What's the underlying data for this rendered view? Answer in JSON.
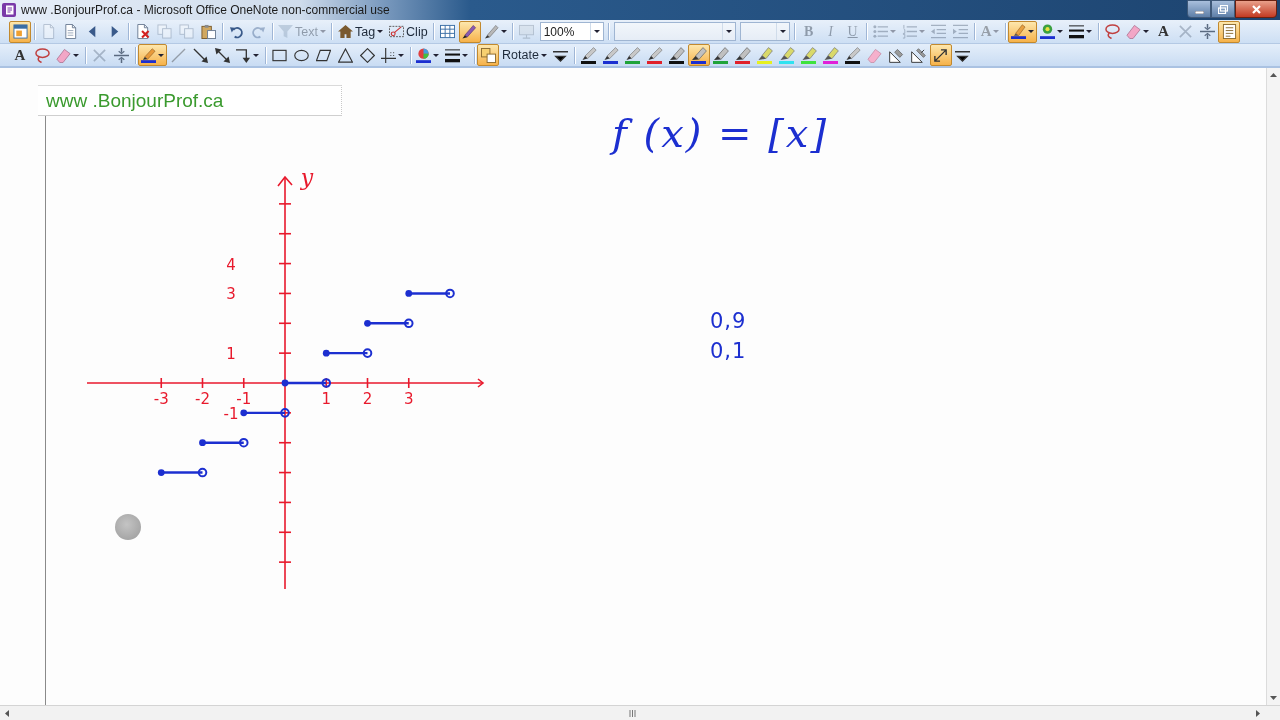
{
  "window": {
    "title": "www .BonjourProf.ca - Microsoft Office OneNote non-commercial use"
  },
  "standard_toolbar": {
    "groups": [
      {
        "items": [
          {
            "kind": "icon",
            "selected": true,
            "disabled": false,
            "menu": false
          }
        ]
      },
      {
        "items": [
          {
            "kind": "icon",
            "selected": false,
            "disabled": true,
            "menu": false
          },
          {
            "kind": "icon",
            "selected": false,
            "disabled": false,
            "menu": false
          },
          {
            "kind": "icon",
            "selected": false,
            "disabled": false,
            "menu": false
          },
          {
            "kind": "icon",
            "selected": false,
            "disabled": false,
            "menu": false
          }
        ]
      },
      {
        "items": [
          {
            "kind": "icon",
            "selected": false,
            "disabled": false,
            "menu": false
          },
          {
            "kind": "icon",
            "selected": false,
            "disabled": true,
            "menu": false
          },
          {
            "kind": "icon",
            "selected": false,
            "disabled": true,
            "menu": false
          },
          {
            "kind": "icon",
            "selected": false,
            "disabled": false,
            "menu": false
          }
        ]
      },
      {
        "items": [
          {
            "kind": "icon",
            "selected": false,
            "disabled": false,
            "menu": false
          },
          {
            "kind": "icon",
            "selected": false,
            "disabled": true,
            "menu": false
          }
        ]
      },
      {
        "items": [
          {
            "kind": "text",
            "label": "Text",
            "selected": false,
            "disabled": true,
            "menu": true
          }
        ]
      },
      {
        "items": [
          {
            "kind": "text",
            "label": "Tag",
            "selected": false,
            "disabled": false,
            "menu": true
          },
          {
            "kind": "text",
            "label": "Clip",
            "selected": false,
            "disabled": false,
            "menu": false
          }
        ]
      },
      {
        "items": [
          {
            "kind": "icon",
            "selected": false,
            "disabled": false,
            "menu": false
          },
          {
            "kind": "icon",
            "selected": true,
            "disabled": false,
            "menu": false
          },
          {
            "kind": "icon",
            "selected": false,
            "disabled": false,
            "menu": true
          }
        ]
      },
      {
        "items": [
          {
            "kind": "icon",
            "selected": false,
            "disabled": true,
            "menu": false
          },
          {
            "kind": "dropdown",
            "value": "100%",
            "selected": false,
            "disabled": false,
            "menu": true
          }
        ]
      },
      {
        "items": [
          {
            "kind": "dropdown",
            "selected": false,
            "disabled": false,
            "menu": true
          },
          {
            "kind": "dropdown",
            "selected": false,
            "disabled": false,
            "menu": true
          }
        ]
      },
      {
        "items": [
          {
            "kind": "bold",
            "label": "B",
            "selected": false,
            "disabled": true,
            "menu": false
          },
          {
            "kind": "italic",
            "label": "I",
            "selected": false,
            "disabled": true,
            "menu": false
          },
          {
            "kind": "underline",
            "label": "U",
            "selected": false,
            "disabled": true,
            "menu": false
          }
        ]
      },
      {
        "items": [
          {
            "kind": "icon",
            "selected": false,
            "disabled": true,
            "menu": true
          },
          {
            "kind": "icon",
            "selected": false,
            "disabled": true,
            "menu": true
          },
          {
            "kind": "icon",
            "selected": false,
            "disabled": true,
            "menu": false
          },
          {
            "kind": "icon",
            "selected": false,
            "disabled": true,
            "menu": false
          }
        ]
      },
      {
        "items": [
          {
            "kind": "glyph",
            "label": "A",
            "selected": false,
            "disabled": true,
            "menu": true
          }
        ]
      },
      {
        "items": [
          {
            "kind": "icon",
            "selected": true,
            "disabled": false,
            "menu": true
          },
          {
            "kind": "icon",
            "selected": false,
            "disabled": false,
            "menu": true
          },
          {
            "kind": "icon",
            "selected": false,
            "disabled": false,
            "menu": true
          }
        ]
      },
      {
        "items": [
          {
            "kind": "icon",
            "selected": false,
            "disabled": false,
            "menu": false
          },
          {
            "kind": "icon",
            "selected": false,
            "disabled": false,
            "menu": true
          },
          {
            "kind": "glyph",
            "label": "A",
            "selected": false,
            "disabled": false,
            "menu": false
          },
          {
            "kind": "icon",
            "selected": false,
            "disabled": true,
            "menu": false
          },
          {
            "kind": "icon",
            "selected": false,
            "disabled": false,
            "menu": false
          },
          {
            "kind": "icon",
            "selected": true,
            "disabled": false,
            "menu": false
          }
        ]
      }
    ]
  },
  "drawing_toolbar": {
    "groups": [
      {
        "items": [
          {
            "kind": "glyph",
            "label": "A",
            "selected": false,
            "disabled": false,
            "menu": false
          },
          {
            "kind": "icon",
            "selected": false,
            "disabled": false,
            "menu": false
          },
          {
            "kind": "icon",
            "selected": false,
            "disabled": false,
            "menu": true
          }
        ]
      },
      {
        "items": [
          {
            "kind": "icon",
            "selected": false,
            "disabled": true,
            "menu": false
          },
          {
            "kind": "icon",
            "selected": false,
            "disabled": false,
            "menu": false
          }
        ]
      },
      {
        "items": [
          {
            "kind": "icon",
            "selected": true,
            "disabled": false,
            "menu": true
          },
          {
            "kind": "icon",
            "selected": false,
            "disabled": true,
            "menu": false
          },
          {
            "kind": "icon",
            "selected": false,
            "disabled": false,
            "menu": false
          },
          {
            "kind": "icon",
            "selected": false,
            "disabled": false,
            "menu": false
          },
          {
            "kind": "icon",
            "selected": false,
            "disabled": false,
            "menu": true
          }
        ]
      },
      {
        "items": [
          {
            "kind": "icon",
            "selected": false,
            "disabled": false,
            "menu": false
          },
          {
            "kind": "icon",
            "selected": false,
            "disabled": false,
            "menu": false
          },
          {
            "kind": "icon",
            "selected": false,
            "disabled": false,
            "menu": false
          },
          {
            "kind": "icon",
            "selected": false,
            "disabled": false,
            "menu": false
          },
          {
            "kind": "icon",
            "selected": false,
            "disabled": false,
            "menu": false
          },
          {
            "kind": "icon",
            "selected": false,
            "disabled": false,
            "menu": true
          }
        ]
      },
      {
        "items": [
          {
            "kind": "icon",
            "selected": false,
            "disabled": false,
            "menu": true
          },
          {
            "kind": "icon",
            "selected": false,
            "disabled": false,
            "menu": true
          }
        ]
      },
      {
        "items": [
          {
            "kind": "icon",
            "selected": true,
            "disabled": false,
            "menu": false
          },
          {
            "kind": "text",
            "label": "Rotate",
            "selected": false,
            "disabled": false,
            "menu": true
          },
          {
            "kind": "icon",
            "selected": false,
            "disabled": false,
            "menu": false
          }
        ]
      },
      {
        "items": [
          {
            "kind": "pen",
            "color": "#111111",
            "selected": false,
            "disabled": false,
            "menu": false
          },
          {
            "kind": "pen",
            "color": "#1c2fd0",
            "selected": false,
            "disabled": false,
            "menu": false
          },
          {
            "kind": "pen",
            "color": "#1fa33a",
            "selected": false,
            "disabled": false,
            "menu": false
          },
          {
            "kind": "pen",
            "color": "#e0202a",
            "selected": false,
            "disabled": false,
            "menu": false
          },
          {
            "kind": "marker",
            "color": "#111111",
            "selected": false,
            "disabled": false,
            "menu": false
          },
          {
            "kind": "marker",
            "color": "#1c2fd0",
            "selected": true,
            "disabled": false,
            "menu": false
          },
          {
            "kind": "marker",
            "color": "#1fa33a",
            "selected": false,
            "disabled": false,
            "menu": false
          },
          {
            "kind": "marker",
            "color": "#e0202a",
            "selected": false,
            "disabled": false,
            "menu": false
          },
          {
            "kind": "highlighter",
            "color": "#e6f020",
            "selected": false,
            "disabled": false,
            "menu": false
          },
          {
            "kind": "highlighter",
            "color": "#30e2f0",
            "selected": false,
            "disabled": false,
            "menu": false
          },
          {
            "kind": "highlighter",
            "color": "#3ee23e",
            "selected": false,
            "disabled": false,
            "menu": false
          },
          {
            "kind": "highlighter",
            "color": "#e020d8",
            "selected": false,
            "disabled": false,
            "menu": false
          },
          {
            "kind": "pen",
            "color": "#111111",
            "selected": false,
            "disabled": false,
            "menu": false
          },
          {
            "kind": "icon",
            "selected": false,
            "disabled": false,
            "menu": false
          },
          {
            "kind": "icon",
            "selected": false,
            "disabled": false,
            "menu": false
          },
          {
            "kind": "icon",
            "selected": false,
            "disabled": false,
            "menu": false
          },
          {
            "kind": "icon",
            "selected": true,
            "disabled": false,
            "menu": false
          },
          {
            "kind": "icon",
            "selected": false,
            "disabled": false,
            "menu": false
          }
        ]
      }
    ]
  },
  "page": {
    "title": "www .BonjourProf.ca",
    "formula": "f (x) = [x]",
    "notes": [
      "0,9",
      "0,1"
    ],
    "graph": {
      "chart_data": {
        "type": "line",
        "ylabel": "y",
        "x": [
          -3,
          -2,
          -1,
          0,
          1,
          2,
          3,
          4
        ],
        "series": [
          {
            "color": "#1c2fd0",
            "marker": "o",
            "values": [
              -3,
              -3,
              null,
              null,
              null,
              null,
              null,
              null
            ]
          },
          {
            "color": "#1c2fd0",
            "marker": "o",
            "values": [
              null,
              -2,
              -2,
              null,
              null,
              null,
              null,
              null
            ]
          },
          {
            "color": "#1c2fd0",
            "marker": "o",
            "values": [
              null,
              null,
              -1,
              -1,
              null,
              null,
              null,
              null
            ]
          },
          {
            "color": "#1c2fd0",
            "marker": "o",
            "values": [
              null,
              null,
              null,
              0,
              0,
              null,
              null,
              null
            ]
          },
          {
            "color": "#1c2fd0",
            "marker": "o",
            "values": [
              null,
              null,
              null,
              null,
              1,
              1,
              null,
              null
            ]
          },
          {
            "color": "#1c2fd0",
            "marker": "o",
            "values": [
              null,
              null,
              null,
              null,
              null,
              2,
              2,
              null
            ]
          },
          {
            "color": "#1c2fd0",
            "marker": "o",
            "values": [
              null,
              null,
              null,
              null,
              null,
              null,
              3,
              3
            ]
          }
        ],
        "ref_lines": [
          {
            "axis": "x",
            "value": 0,
            "color": "#e8192c"
          }
        ],
        "xlim": [
          -4.8,
          4.8
        ],
        "ylim": [
          -6.9,
          6.9
        ],
        "xticks": [
          -3,
          -2,
          -1,
          1,
          2,
          3
        ],
        "yticks": [
          4,
          3,
          1,
          -1
        ]
      }
    }
  }
}
